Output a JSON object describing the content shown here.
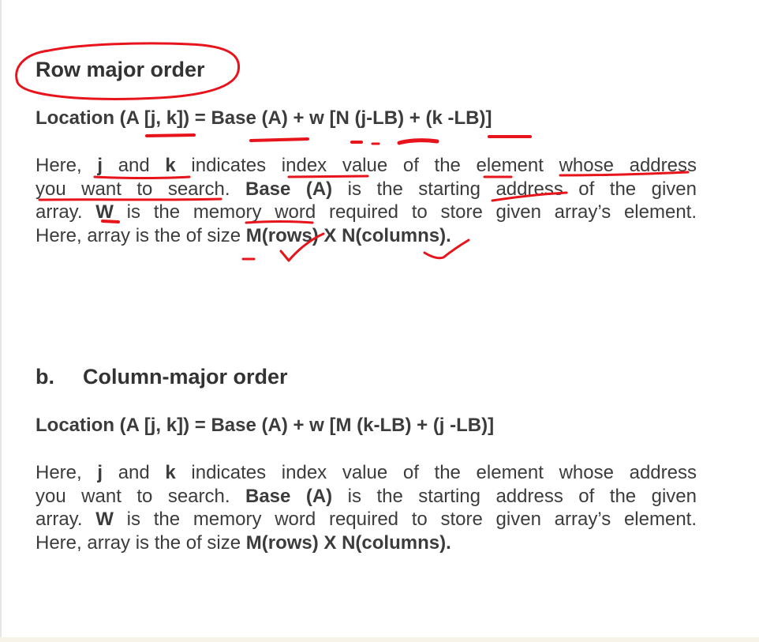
{
  "section_a": {
    "heading": "Row major order",
    "formula": "Location (A [j, k]) = Base (A) + w [N (j-LB) + (k -LB)]",
    "paragraph": {
      "l1_a": "Here, ",
      "l1_b": "j",
      "l1_c": " and ",
      "l1_d": "k",
      "l1_e": " indicates index value of the element whose address",
      "l2_a": "you want to search. ",
      "l2_b": "Base (A)",
      "l2_c": " is the starting address of the given",
      "l3_a": "array. ",
      "l3_b": "W",
      "l3_c": " is the memory word required to store given array’s element.",
      "l4_a": "Here, array is the of size ",
      "l4_b": "M(rows) X N(columns)."
    }
  },
  "section_b": {
    "label": "b.",
    "heading": "Column-major order",
    "formula": "Location (A [j, k]) = Base (A) + w [M (k-LB) + (j -LB)]",
    "paragraph": {
      "l1_a": "Here, ",
      "l1_b": "j",
      "l1_c": " and ",
      "l1_d": "k",
      "l1_e": " indicates index value of the element whose address",
      "l2_a": "you want to search. ",
      "l2_b": "Base (A)",
      "l2_c": " is the starting address of the given",
      "l3_a": "array. ",
      "l3_b": "W",
      "l3_c": " is the memory word required to store given array’s element.",
      "l4_a": "Here, array is the of size ",
      "l4_b": "M(rows) X N(columns)."
    }
  },
  "annotation_color": "#e8141c"
}
